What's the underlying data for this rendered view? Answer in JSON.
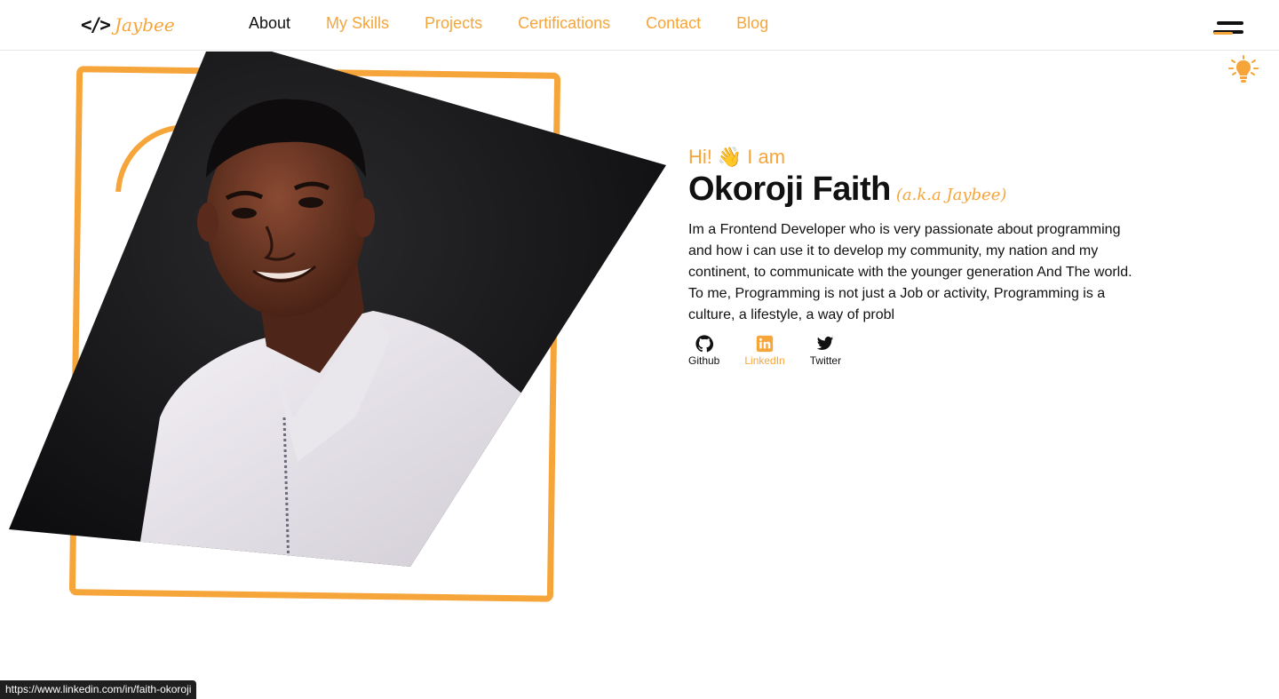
{
  "nav": {
    "logo_icon": "</>",
    "logo_text": "Jaybee",
    "links": [
      {
        "label": "About",
        "active": true
      },
      {
        "label": "My Skills",
        "active": false
      },
      {
        "label": "Projects",
        "active": false
      },
      {
        "label": "Certifications",
        "active": false
      },
      {
        "label": "Contact",
        "active": false
      },
      {
        "label": "Blog",
        "active": false
      }
    ],
    "menu_icon": "hamburger-menu-icon",
    "theme_icon": "lightbulb-icon"
  },
  "hero": {
    "greeting": "Hi!",
    "wave": "👋",
    "greeting_tail": "I am",
    "name": "Okoroji Faith",
    "aka": "(a.k.a Jaybee)",
    "bio": "Im a Frontend Developer who is very passionate about programming and how i can use it to develop my community, my nation and my continent, to communicate with the younger generation And The world. To me, Programming is not just a Job or activity, Programming is a culture, a lifestyle, a way of probl",
    "socials": [
      {
        "label": "Github",
        "icon": "github-icon"
      },
      {
        "label": "LinkedIn",
        "icon": "linkedin-icon"
      },
      {
        "label": "Twitter",
        "icon": "twitter-icon"
      }
    ]
  },
  "status_bar": {
    "url": "https://www.linkedin.com/in/faith-okoroji"
  },
  "colors": {
    "accent": "#f6a53a",
    "text": "#111111",
    "background": "#ffffff"
  }
}
